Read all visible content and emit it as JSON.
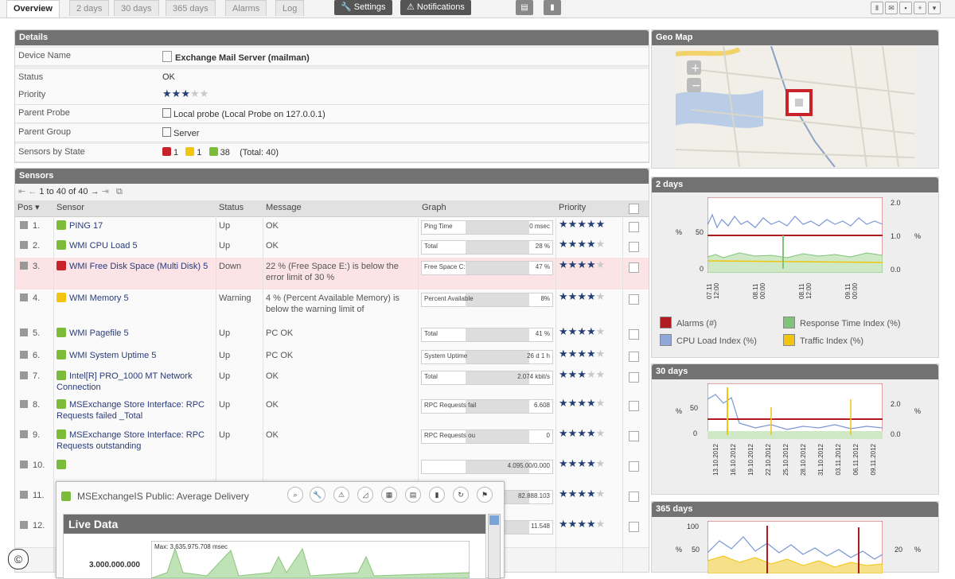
{
  "tabs": [
    "Overview",
    "2 days",
    "30 days",
    "365 days",
    "Alarms",
    "Log"
  ],
  "toolbar": {
    "settings": "Settings",
    "notifications": "Notifications"
  },
  "details": {
    "title": "Details",
    "rows": [
      {
        "k": "Device Name",
        "v": "Exchange Mail Server (mailman)"
      },
      {
        "k": "Status",
        "v": "OK"
      },
      {
        "k": "Priority",
        "v": ""
      },
      {
        "k": "Parent Probe",
        "v": "Local probe (Local Probe on 127.0.0.1)"
      },
      {
        "k": "Parent Group",
        "v": "Server"
      },
      {
        "k": "Sensors by State",
        "v": ""
      }
    ],
    "priority_stars": 3,
    "state_counts": {
      "down": "1",
      "warning": "1",
      "up": "38",
      "total": "(Total: 40)"
    }
  },
  "sensors": {
    "title": "Sensors",
    "pager": "1 to 40 of 40",
    "headers": {
      "pos": "Pos",
      "sensor": "Sensor",
      "status": "Status",
      "message": "Message",
      "graph": "Graph",
      "priority": "Priority"
    },
    "rows": [
      {
        "pos": "1.",
        "name": "PING 17",
        "status": "Up",
        "message": "OK",
        "glabel": "Ping Time",
        "gval": "0 msec",
        "stars": 5,
        "state": "up"
      },
      {
        "pos": "2.",
        "name": "WMI CPU Load 5",
        "status": "Up",
        "message": "OK",
        "glabel": "Total",
        "gval": "28 %",
        "stars": 4,
        "state": "up"
      },
      {
        "pos": "3.",
        "name": "WMI Free Disk Space (Multi Disk) 5",
        "status": "Down",
        "message": "22 % (Free Space E:) is below the error limit of 30 %",
        "glabel": "Free Space C:",
        "gval": "47 %",
        "stars": 4,
        "state": "down"
      },
      {
        "pos": "4.",
        "name": "WMI Memory 5",
        "status": "Warning",
        "message": "4 % (Percent Available Memory) is below the warning limit of",
        "glabel": "Percent Available",
        "gval": "8%",
        "stars": 4,
        "state": "warn"
      },
      {
        "pos": "5.",
        "name": "WMI Pagefile 5",
        "status": "Up",
        "message": "PC OK",
        "glabel": "Total",
        "gval": "41 %",
        "stars": 4,
        "state": "up"
      },
      {
        "pos": "6.",
        "name": "WMI System Uptime 5",
        "status": "Up",
        "message": "PC OK",
        "glabel": "System Uptime",
        "gval": "26 d 1 h",
        "stars": 4,
        "state": "up"
      },
      {
        "pos": "7.",
        "name": "Intel[R] PRO_1000 MT Network Connection",
        "status": "Up",
        "message": "OK",
        "glabel": "Total",
        "gval": "2.074 kbit/s",
        "stars": 3,
        "state": "up"
      },
      {
        "pos": "8.",
        "name": "MSExchange Store Interface: RPC Requests failed _Total",
        "status": "Up",
        "message": "OK",
        "glabel": "RPC Requests fail",
        "gval": "6.608",
        "stars": 4,
        "state": "up"
      },
      {
        "pos": "9.",
        "name": "MSExchange Store Interface: RPC Requests outstanding",
        "status": "Up",
        "message": "OK",
        "glabel": "RPC Requests ou",
        "gval": "0",
        "stars": 4,
        "state": "up"
      },
      {
        "pos": "10.",
        "name": "",
        "status": "",
        "message": "",
        "glabel": "",
        "gval": "4.095.00/0.000",
        "stars": 4,
        "state": "up"
      },
      {
        "pos": "11.",
        "name": "",
        "status": "",
        "message": "",
        "glabel": "",
        "gval": "82.888.103",
        "stars": 4,
        "state": "up"
      },
      {
        "pos": "12.",
        "name": "",
        "status": "",
        "message": "",
        "glabel": "",
        "gval": "11.548",
        "stars": 4,
        "state": "up"
      }
    ]
  },
  "geomap": {
    "title": "Geo Map"
  },
  "chart2": {
    "title": "2 days",
    "yleft": [
      "50",
      "0"
    ],
    "yright": [
      "2.0",
      "1.0",
      "0.0"
    ],
    "xticks": [
      "07.11 12:00",
      "08.11 00:00",
      "08.11 12:00",
      "09.11 00:00"
    ],
    "unit": "%"
  },
  "chart30": {
    "title": "30 days",
    "yleft": [
      "50",
      "0"
    ],
    "yright": [
      "2.0",
      "0.0"
    ],
    "xticks": [
      "13.10.2012",
      "16.10.2012",
      "19.10.2012",
      "22.10.2012",
      "25.10.2012",
      "28.10.2012",
      "31.10.2012",
      "03.11.2012",
      "06.11.2012",
      "09.11.2012"
    ],
    "unit": "%"
  },
  "chart365": {
    "title": "365 days",
    "yleft": [
      "100",
      "50"
    ],
    "yright": [
      "20"
    ],
    "unit": "%"
  },
  "legend": [
    {
      "label": "Alarms (#)",
      "color": "#b01b22"
    },
    {
      "label": "Response Time Index (%)",
      "color": "#7fc47a"
    },
    {
      "label": "CPU Load Index (%)",
      "color": "#8fa8d9"
    },
    {
      "label": "Traffic Index (%)",
      "color": "#f1c40f"
    }
  ],
  "popup": {
    "title": "MSExchangeIS Public: Average Delivery",
    "live": "Live Data",
    "max": "Max: 3.635.975.708 msec",
    "ylabel": "3.000.000.000"
  },
  "copyright": "©"
}
